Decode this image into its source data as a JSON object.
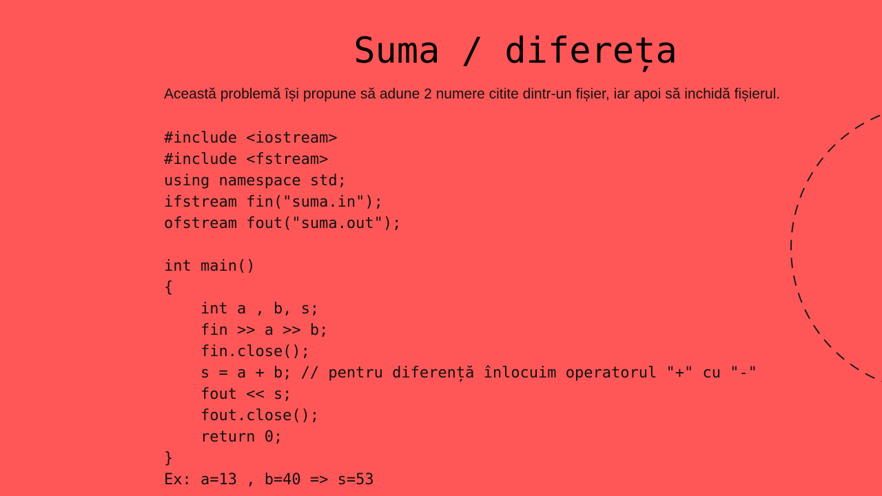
{
  "slide": {
    "title": "Suma / difereța",
    "description": "Această problemă își propune să adune 2 numere citite dintr-un fișier, iar apoi să inchidă fișierul.",
    "code_lines": [
      "#include <iostream>",
      "#include <fstream>",
      "using namespace std;",
      "ifstream fin(\"suma.in\");",
      "ofstream fout(\"suma.out\");",
      "",
      "int main()",
      "{",
      "    int a , b, s;",
      "    fin >> a >> b;",
      "    fin.close();",
      "    s = a + b; // pentru diferență înlocuim operatorul \"+\" cu \"-\"",
      "    fout << s;",
      "    fout.close();",
      "    return 0;",
      "}",
      "Ex: a=13 , b=40 => s=53"
    ]
  },
  "colors": {
    "background": "#FF5757",
    "text": "#000000",
    "decoration": "#1A1A1A"
  },
  "decoration": {
    "icon": "dashed-circle"
  }
}
